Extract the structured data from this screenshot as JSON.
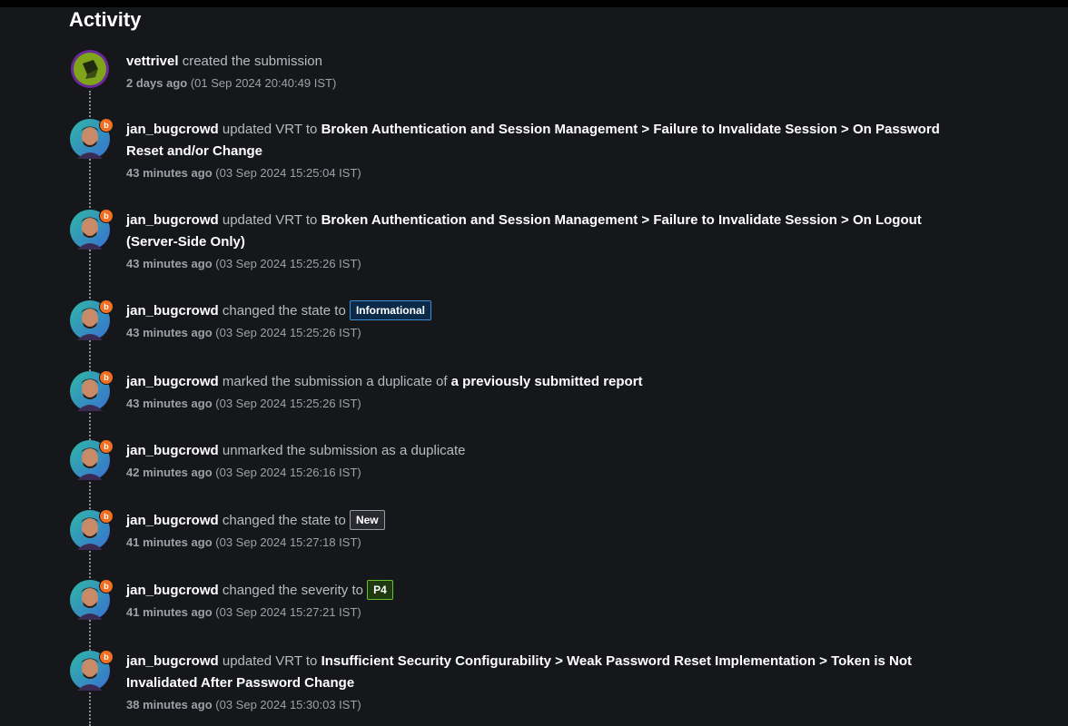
{
  "title": "Activity",
  "colors": {
    "background": "#16171b",
    "badge_orange": "#f26f21",
    "informational": "#3f8fd6",
    "p4": "#6bbf2c"
  },
  "events": [
    {
      "user": "vettrivel",
      "action": "created the submission",
      "relative": "2 days ago",
      "absolute": "(01 Sep 2024 20:40:49 IST)"
    },
    {
      "user": "jan_bugcrowd",
      "action": "updated VRT to",
      "vrt": "Broken Authentication and Session Management > Failure to Invalidate Session > On Password Reset and/or Change",
      "relative": "43 minutes ago",
      "absolute": "(03 Sep 2024 15:25:04 IST)"
    },
    {
      "user": "jan_bugcrowd",
      "action": "updated VRT to",
      "vrt": "Broken Authentication and Session Management > Failure to Invalidate Session > On Logout (Server-Side Only)",
      "relative": "43 minutes ago",
      "absolute": "(03 Sep 2024 15:25:26 IST)"
    },
    {
      "user": "jan_bugcrowd",
      "action": "changed the state to",
      "pill": "Informational",
      "relative": "43 minutes ago",
      "absolute": "(03 Sep 2024 15:25:26 IST)"
    },
    {
      "user": "jan_bugcrowd",
      "action": "marked the submission a duplicate of",
      "link": "a previously submitted report",
      "relative": "43 minutes ago",
      "absolute": "(03 Sep 2024 15:25:26 IST)"
    },
    {
      "user": "jan_bugcrowd",
      "action": "unmarked the submission as a duplicate",
      "relative": "42 minutes ago",
      "absolute": "(03 Sep 2024 15:26:16 IST)"
    },
    {
      "user": "jan_bugcrowd",
      "action": "changed the state to",
      "pill": "New",
      "relative": "41 minutes ago",
      "absolute": "(03 Sep 2024 15:27:18 IST)"
    },
    {
      "user": "jan_bugcrowd",
      "action": "changed the severity to",
      "pill": "P4",
      "relative": "41 minutes ago",
      "absolute": "(03 Sep 2024 15:27:21 IST)"
    },
    {
      "user": "jan_bugcrowd",
      "action": "updated VRT to",
      "vrt": "Insufficient Security Configurability > Weak Password Reset Implementation > Token is Not Invalidated After Password Change",
      "relative": "38 minutes ago",
      "absolute": "(03 Sep 2024 15:30:03 IST)"
    }
  ],
  "badge_letter": "b"
}
